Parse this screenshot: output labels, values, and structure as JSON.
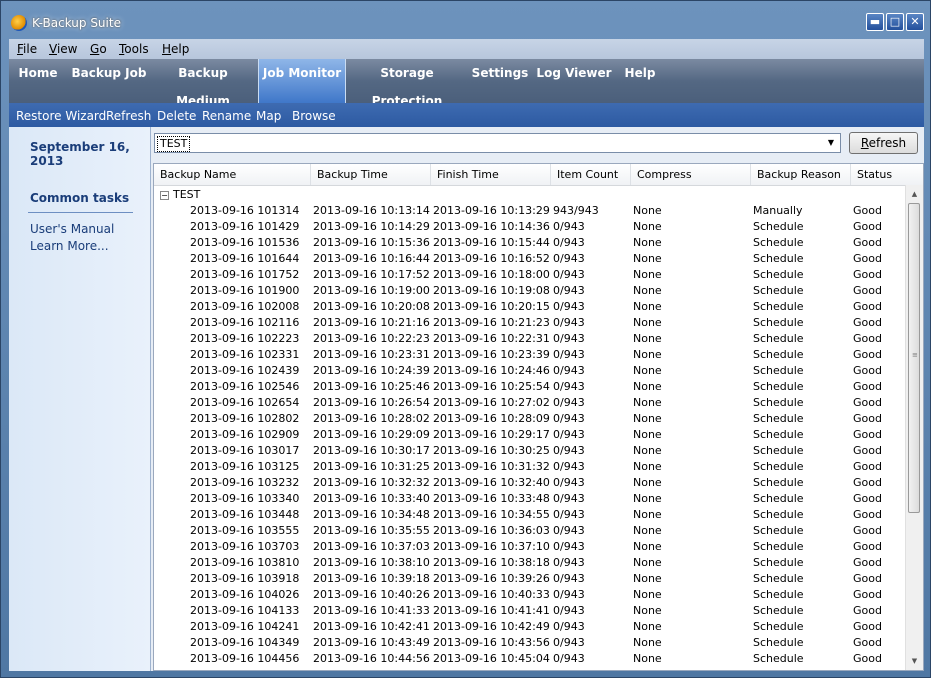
{
  "window": {
    "title": "K-Backup Suite"
  },
  "menu": [
    {
      "label": "File",
      "accel": "F",
      "rest": "ile"
    },
    {
      "label": "View",
      "accel": "V",
      "rest": "iew"
    },
    {
      "label": "Go",
      "accel": "G",
      "rest": "o"
    },
    {
      "label": "Tools",
      "accel": "T",
      "rest": "ools"
    },
    {
      "label": "Help",
      "accel": "H",
      "rest": "elp"
    }
  ],
  "tabs": [
    "Home",
    "Backup Job",
    "Backup Medium",
    "Job Monitor",
    "Storage Protection",
    "Settings",
    "Log Viewer",
    "Help"
  ],
  "active_tab": "Job Monitor",
  "toolbar": [
    "Restore Wizard",
    "Refresh",
    "Delete",
    "Rename",
    "Map",
    "Browse"
  ],
  "left": {
    "date": "September 16, 2013",
    "tasks_heading": "Common tasks",
    "links": [
      "User's Manual",
      "Learn More..."
    ]
  },
  "job_select": {
    "value": "TEST"
  },
  "refresh_button": {
    "label": "Refresh"
  },
  "columns": [
    "Backup Name",
    "Backup Time",
    "Finish Time",
    "Item Count",
    "Compress",
    "Backup Reason",
    "Status"
  ],
  "group": "TEST",
  "rows": [
    [
      "2013-09-16 101314",
      "2013-09-16 10:13:14",
      "2013-09-16 10:13:29",
      "943/943",
      "None",
      "Manually",
      "Good"
    ],
    [
      "2013-09-16 101429",
      "2013-09-16 10:14:29",
      "2013-09-16 10:14:36",
      "0/943",
      "None",
      "Schedule",
      "Good"
    ],
    [
      "2013-09-16 101536",
      "2013-09-16 10:15:36",
      "2013-09-16 10:15:44",
      "0/943",
      "None",
      "Schedule",
      "Good"
    ],
    [
      "2013-09-16 101644",
      "2013-09-16 10:16:44",
      "2013-09-16 10:16:52",
      "0/943",
      "None",
      "Schedule",
      "Good"
    ],
    [
      "2013-09-16 101752",
      "2013-09-16 10:17:52",
      "2013-09-16 10:18:00",
      "0/943",
      "None",
      "Schedule",
      "Good"
    ],
    [
      "2013-09-16 101900",
      "2013-09-16 10:19:00",
      "2013-09-16 10:19:08",
      "0/943",
      "None",
      "Schedule",
      "Good"
    ],
    [
      "2013-09-16 102008",
      "2013-09-16 10:20:08",
      "2013-09-16 10:20:15",
      "0/943",
      "None",
      "Schedule",
      "Good"
    ],
    [
      "2013-09-16 102116",
      "2013-09-16 10:21:16",
      "2013-09-16 10:21:23",
      "0/943",
      "None",
      "Schedule",
      "Good"
    ],
    [
      "2013-09-16 102223",
      "2013-09-16 10:22:23",
      "2013-09-16 10:22:31",
      "0/943",
      "None",
      "Schedule",
      "Good"
    ],
    [
      "2013-09-16 102331",
      "2013-09-16 10:23:31",
      "2013-09-16 10:23:39",
      "0/943",
      "None",
      "Schedule",
      "Good"
    ],
    [
      "2013-09-16 102439",
      "2013-09-16 10:24:39",
      "2013-09-16 10:24:46",
      "0/943",
      "None",
      "Schedule",
      "Good"
    ],
    [
      "2013-09-16 102546",
      "2013-09-16 10:25:46",
      "2013-09-16 10:25:54",
      "0/943",
      "None",
      "Schedule",
      "Good"
    ],
    [
      "2013-09-16 102654",
      "2013-09-16 10:26:54",
      "2013-09-16 10:27:02",
      "0/943",
      "None",
      "Schedule",
      "Good"
    ],
    [
      "2013-09-16 102802",
      "2013-09-16 10:28:02",
      "2013-09-16 10:28:09",
      "0/943",
      "None",
      "Schedule",
      "Good"
    ],
    [
      "2013-09-16 102909",
      "2013-09-16 10:29:09",
      "2013-09-16 10:29:17",
      "0/943",
      "None",
      "Schedule",
      "Good"
    ],
    [
      "2013-09-16 103017",
      "2013-09-16 10:30:17",
      "2013-09-16 10:30:25",
      "0/943",
      "None",
      "Schedule",
      "Good"
    ],
    [
      "2013-09-16 103125",
      "2013-09-16 10:31:25",
      "2013-09-16 10:31:32",
      "0/943",
      "None",
      "Schedule",
      "Good"
    ],
    [
      "2013-09-16 103232",
      "2013-09-16 10:32:32",
      "2013-09-16 10:32:40",
      "0/943",
      "None",
      "Schedule",
      "Good"
    ],
    [
      "2013-09-16 103340",
      "2013-09-16 10:33:40",
      "2013-09-16 10:33:48",
      "0/943",
      "None",
      "Schedule",
      "Good"
    ],
    [
      "2013-09-16 103448",
      "2013-09-16 10:34:48",
      "2013-09-16 10:34:55",
      "0/943",
      "None",
      "Schedule",
      "Good"
    ],
    [
      "2013-09-16 103555",
      "2013-09-16 10:35:55",
      "2013-09-16 10:36:03",
      "0/943",
      "None",
      "Schedule",
      "Good"
    ],
    [
      "2013-09-16 103703",
      "2013-09-16 10:37:03",
      "2013-09-16 10:37:10",
      "0/943",
      "None",
      "Schedule",
      "Good"
    ],
    [
      "2013-09-16 103810",
      "2013-09-16 10:38:10",
      "2013-09-16 10:38:18",
      "0/943",
      "None",
      "Schedule",
      "Good"
    ],
    [
      "2013-09-16 103918",
      "2013-09-16 10:39:18",
      "2013-09-16 10:39:26",
      "0/943",
      "None",
      "Schedule",
      "Good"
    ],
    [
      "2013-09-16 104026",
      "2013-09-16 10:40:26",
      "2013-09-16 10:40:33",
      "0/943",
      "None",
      "Schedule",
      "Good"
    ],
    [
      "2013-09-16 104133",
      "2013-09-16 10:41:33",
      "2013-09-16 10:41:41",
      "0/943",
      "None",
      "Schedule",
      "Good"
    ],
    [
      "2013-09-16 104241",
      "2013-09-16 10:42:41",
      "2013-09-16 10:42:49",
      "0/943",
      "None",
      "Schedule",
      "Good"
    ],
    [
      "2013-09-16 104349",
      "2013-09-16 10:43:49",
      "2013-09-16 10:43:56",
      "0/943",
      "None",
      "Schedule",
      "Good"
    ],
    [
      "2013-09-16 104456",
      "2013-09-16 10:44:56",
      "2013-09-16 10:45:04",
      "0/943",
      "None",
      "Schedule",
      "Good"
    ]
  ]
}
